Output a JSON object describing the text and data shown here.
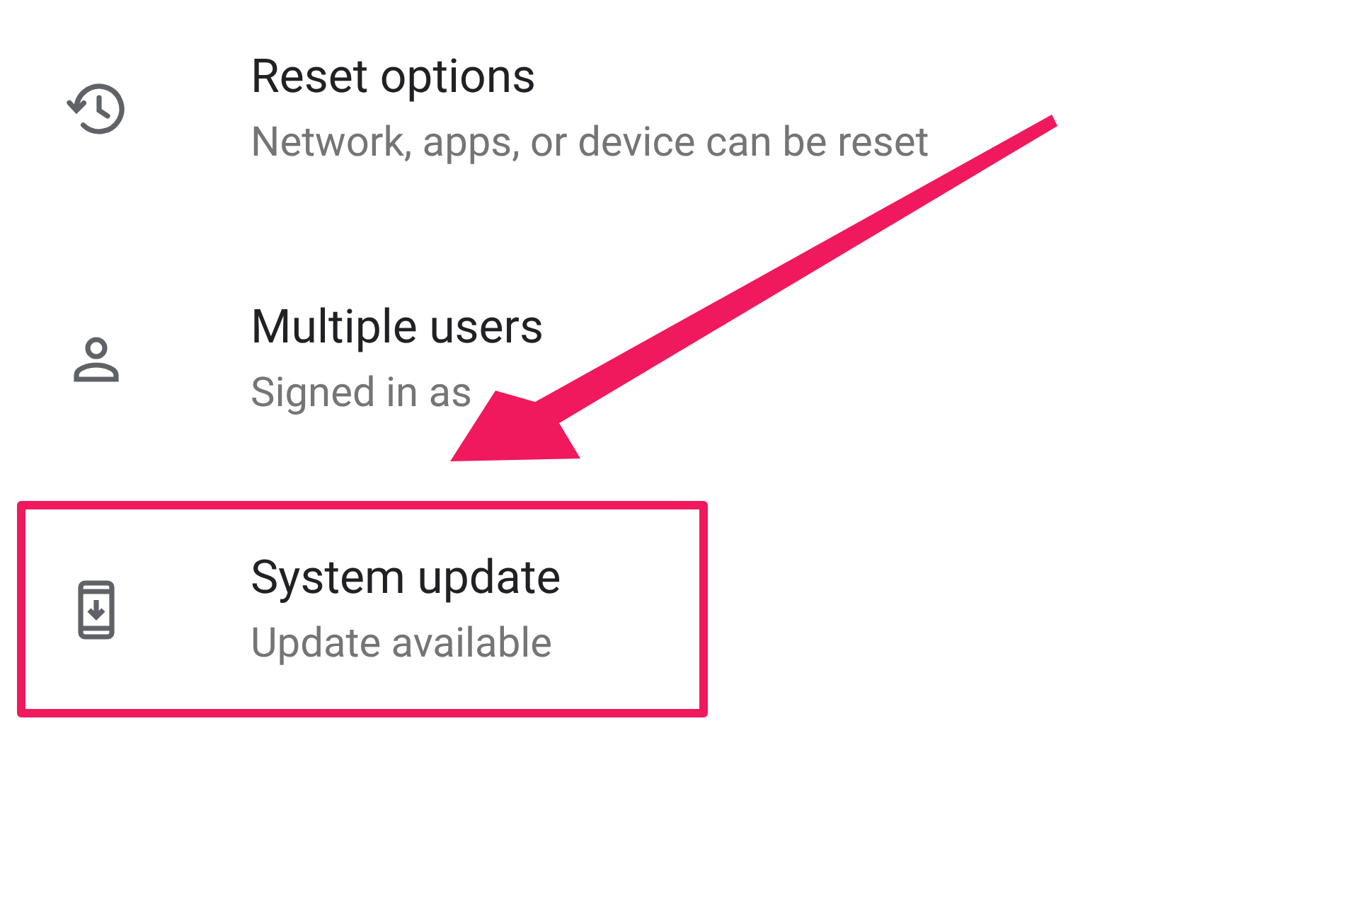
{
  "settings_items": [
    {
      "kind": "history",
      "title": "Reset options",
      "summary": "Network, apps, or device can be reset",
      "highlighted": false
    },
    {
      "kind": "person",
      "title": "Multiple users",
      "summary": "Signed in as",
      "highlighted": false
    },
    {
      "kind": "phone-download",
      "title": "System update",
      "summary": "Update available",
      "highlighted": true
    }
  ]
}
